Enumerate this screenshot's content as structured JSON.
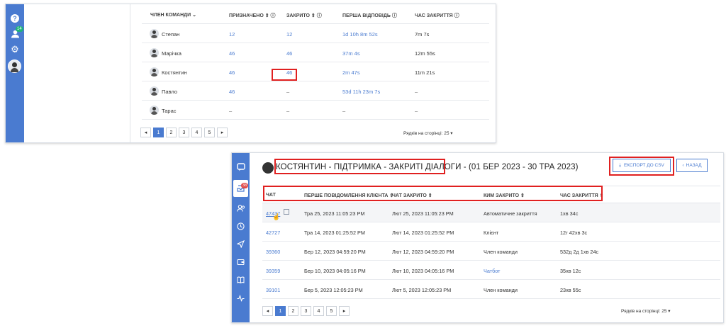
{
  "panel1": {
    "headers": [
      "ЧЛЕН КОМАНДИ",
      "ПРИЗНАЧЕНО",
      "ЗАКРИТО",
      "ПЕРША ВІДПОВІДЬ",
      "ЧАС ЗАКРИТТЯ"
    ],
    "rows": [
      {
        "name": "Степан",
        "assigned": "12",
        "closed": "12",
        "first": "1d 10h 8m 52s",
        "close_time": "7m 7s"
      },
      {
        "name": "Марічка",
        "assigned": "46",
        "closed": "46",
        "first": "37m 4s",
        "close_time": "12m 55s"
      },
      {
        "name": "Костянтин",
        "assigned": "46",
        "closed": "46",
        "first": "2m 47s",
        "close_time": "11m 21s"
      },
      {
        "name": "Павло",
        "assigned": "46",
        "closed": "–",
        "first": "53d 11h 23m 7s",
        "close_time": "–"
      },
      {
        "name": "Тарас",
        "assigned": "–",
        "closed": "–",
        "first": "–",
        "close_time": "–"
      }
    ],
    "sidebar_badge": "14",
    "pages": [
      "1",
      "2",
      "3",
      "4",
      "5"
    ],
    "rows_per_page_label": "Рядків на сторінці:",
    "rows_per_page_value": "25"
  },
  "panel2": {
    "title_highlighted": "КОСТЯНТИН - ПІДТРИМКА - ЗАКРИТІ ДІАЛОГИ",
    "title_rest": " - (01 БЕР 2023 - 30 ТРА 2023)",
    "export_label": "ЕКСПОРТ ДО CSV",
    "back_label": "НАЗАД",
    "sidebar_badge": "38",
    "headers": [
      "ЧАТ",
      "ПЕРШЕ ПОВІДОМЛЕННЯ КЛІЄНТА",
      "ЧАТ ЗАКРИТО",
      "КИМ ЗАКРИТО",
      "ЧАС ЗАКРИТТЯ"
    ],
    "rows": [
      {
        "chat": "47437",
        "first": "Тра 25, 2023   11:05:23 PM",
        "closed": "Лют 25, 2023   11:05:23 PM",
        "by": "Автоматичне закриття",
        "time": "1хв 34с"
      },
      {
        "chat": "42727",
        "first": "Тра 14, 2023   01:25:52 PM",
        "closed": "Лют 14, 2023   01:25:52 PM",
        "by": "Клієнт",
        "time": "12г 42хв 3с"
      },
      {
        "chat": "39360",
        "first": "Бер 12, 2023   04:59:20 PM",
        "closed": "Лют 12, 2023   04:59:20 PM",
        "by": "Член команди",
        "time": "532д 2д 1хв 24с"
      },
      {
        "chat": "39359",
        "first": "Бер 10, 2023   04:05:16 PM",
        "closed": "Лют 10, 2023   04:05:16 PM",
        "by": "Чатбот",
        "time": "35хв 12с"
      },
      {
        "chat": "39101",
        "first": "Бер 5, 2023   12:05:23 PM",
        "closed": "Лют 5, 2023   12:05:23 PM",
        "by": "Член команди",
        "time": "23хв 55с"
      }
    ],
    "pages": [
      "1",
      "2",
      "3",
      "4",
      "5"
    ],
    "rows_per_page_label": "Рядків на сторінці:",
    "rows_per_page_value": "25"
  },
  "colors": {
    "accent": "#4a7bd0",
    "highlight": "#e02020"
  }
}
